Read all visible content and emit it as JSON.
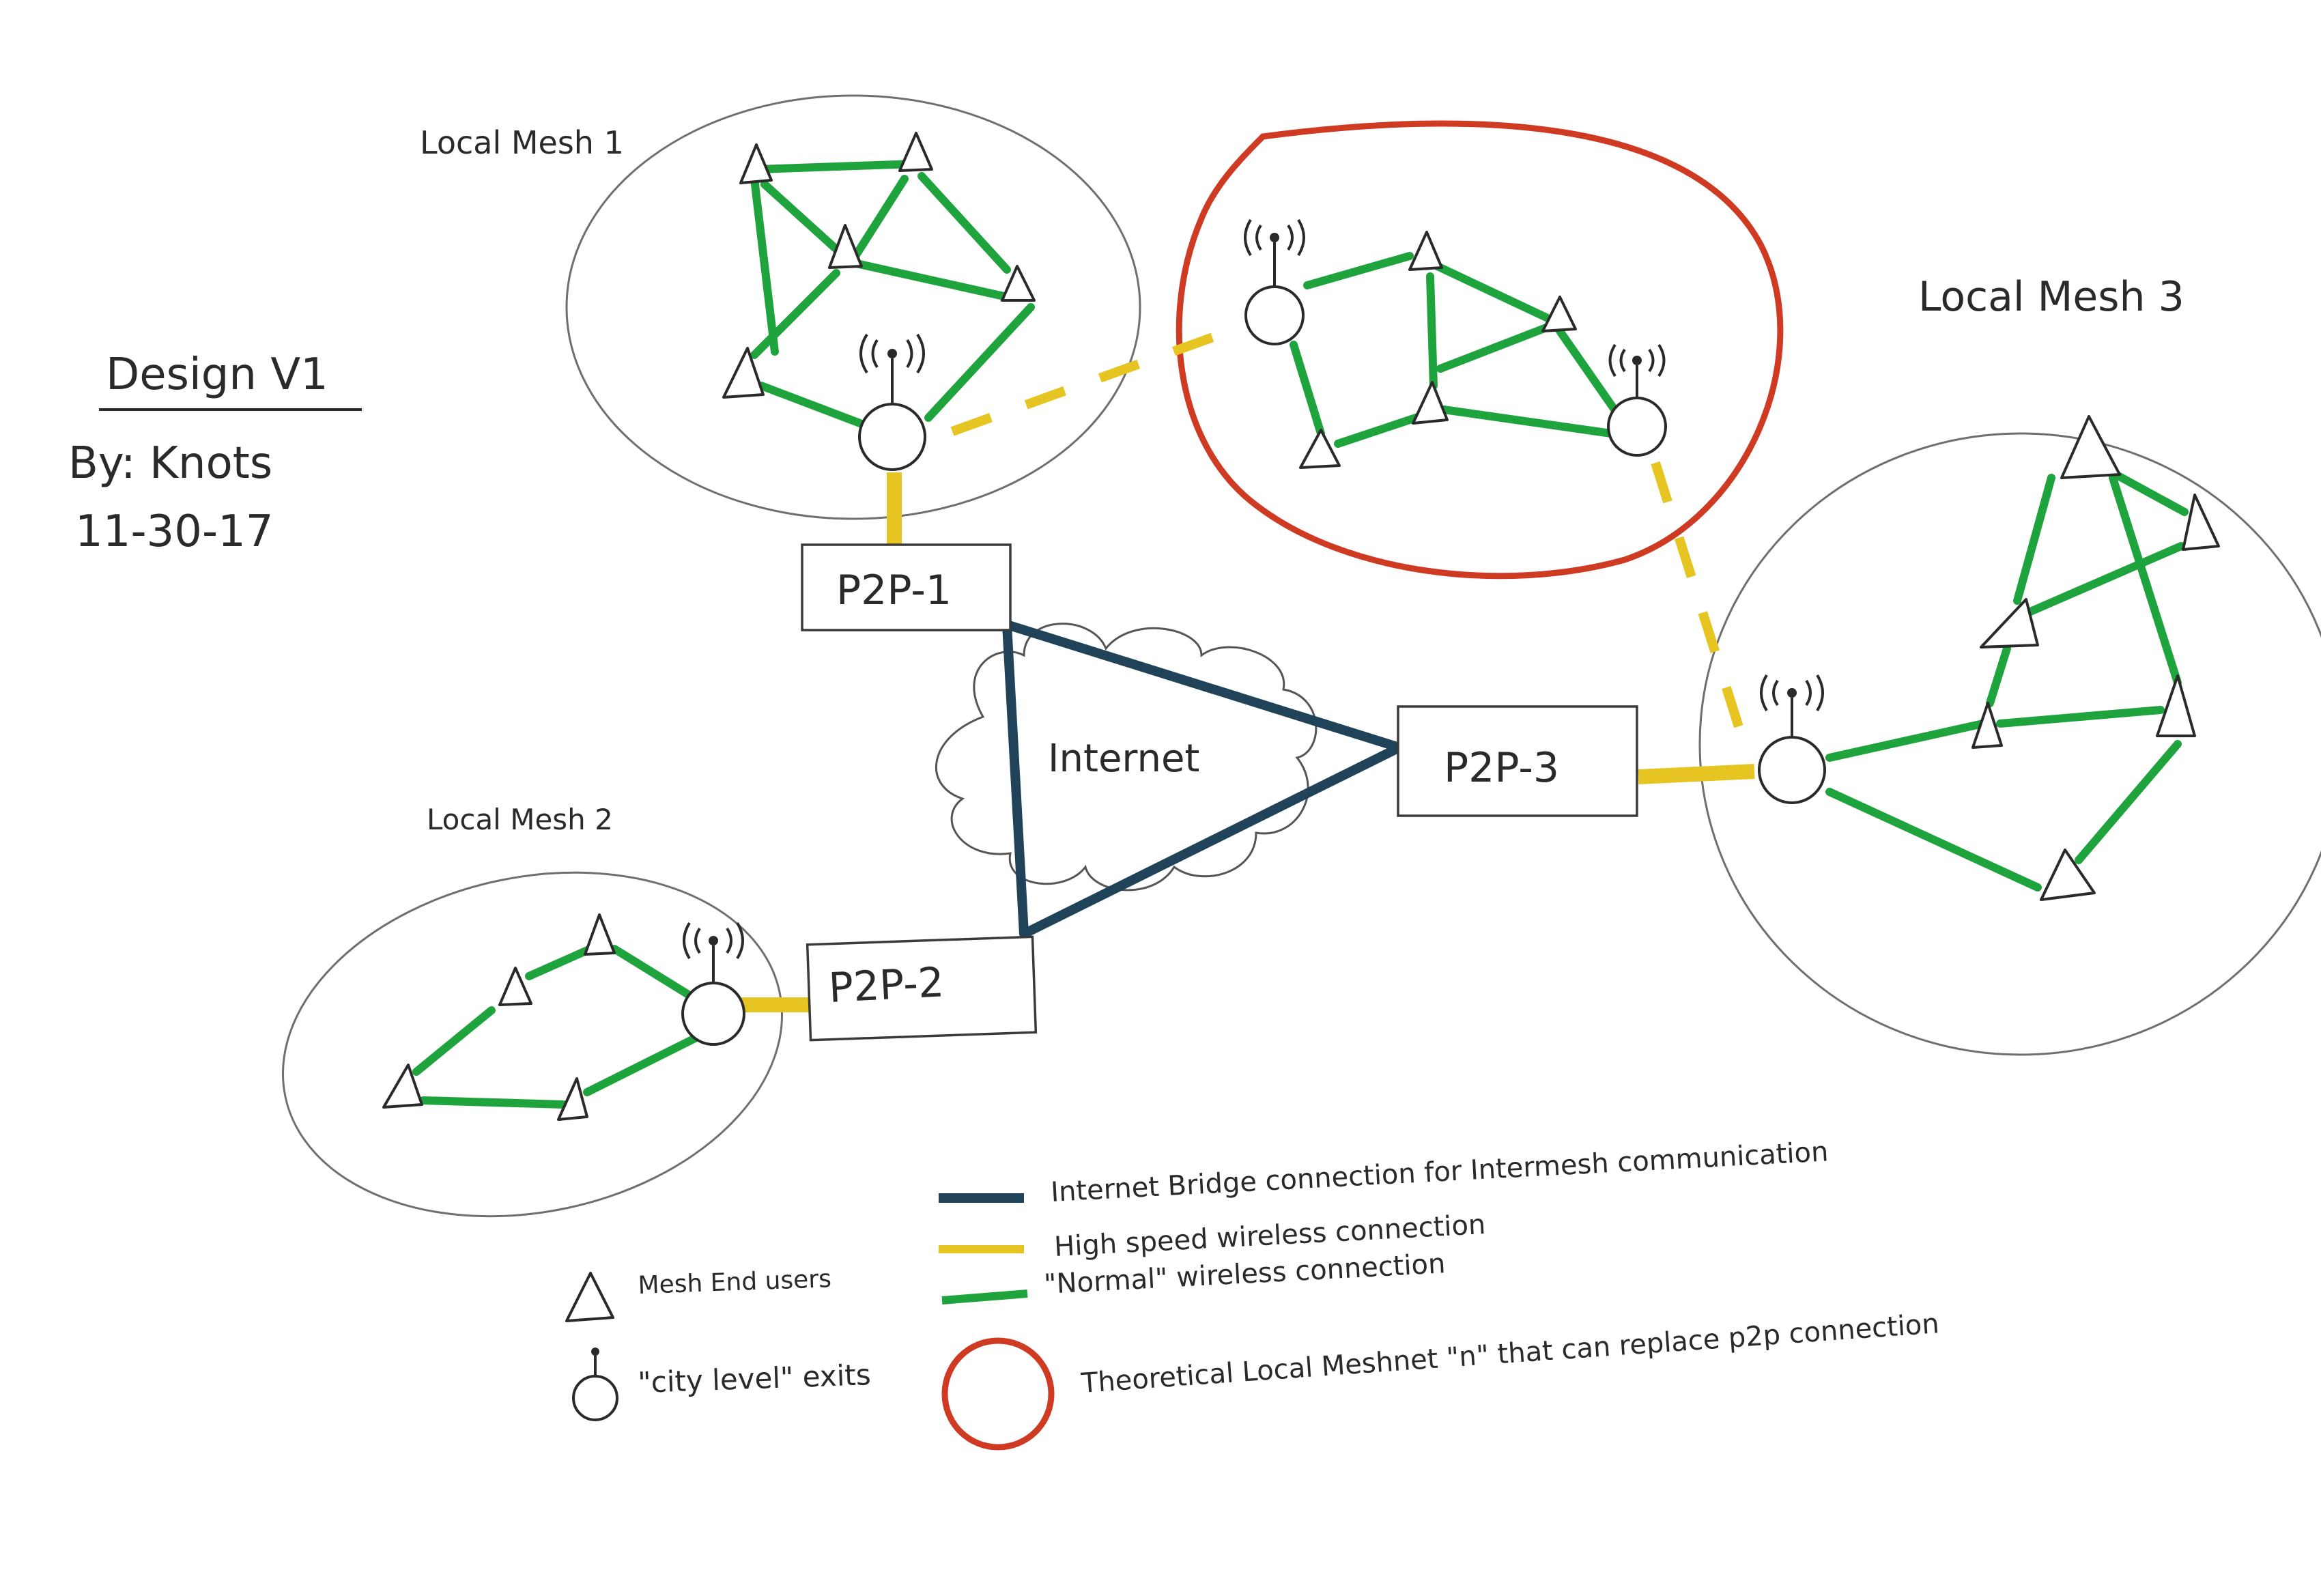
{
  "header": {
    "title": "Design V1",
    "author": "By: Knots",
    "date": "11-30-17"
  },
  "meshes": {
    "mesh1_label": "Local Mesh 1",
    "mesh2_label": "Local Mesh 2",
    "mesh3_label": "Local Mesh 3"
  },
  "nodes": {
    "p2p1": "P2P-1",
    "p2p2": "P2P-2",
    "p2p3": "P2P-3",
    "internet": "Internet"
  },
  "legend": {
    "navy_text": "Internet Bridge connection for Intermesh communication",
    "yellow_text": "High speed wireless connection",
    "green_text": "\"Normal\" wireless connection",
    "triangle_text": "Mesh End users",
    "exit_text": "\"city level\" exits",
    "red_text": "Theoretical Local Meshnet \"n\" that can replace p2p connection"
  },
  "colors": {
    "navy": "#21435a",
    "yellow": "#e6c523",
    "green": "#1fa33d",
    "red": "#cf3a23"
  },
  "icons": {
    "end_user": "triangle-icon",
    "city_exit": "antenna-circle-icon"
  }
}
